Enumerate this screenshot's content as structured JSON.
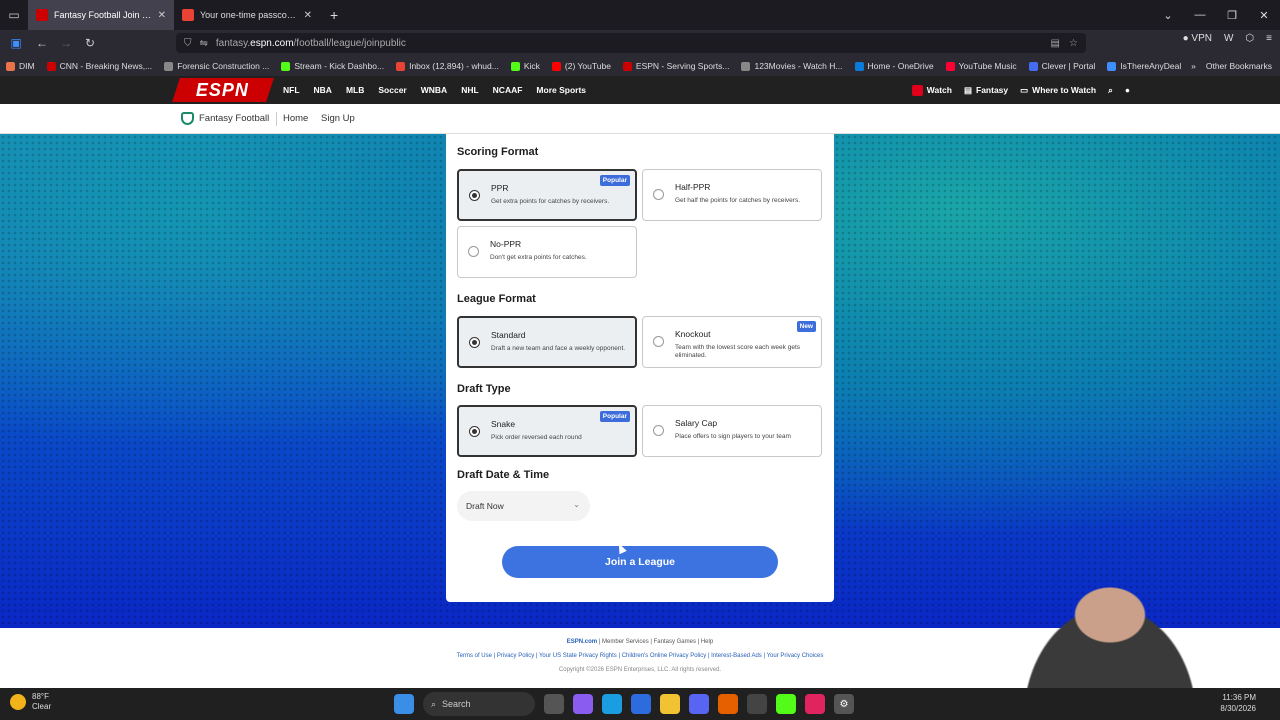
{
  "browser": {
    "tabs": [
      {
        "label": "Fantasy Football Join a Public L",
        "active": true
      },
      {
        "label": "Your one-time passcode for ESP",
        "active": false
      }
    ],
    "url_prefix": "fantasy.",
    "url_host": "espn.com",
    "url_path": "/football/league/joinpublic",
    "vpn_label": "VPN",
    "bookmarks": [
      {
        "label": "DIM",
        "color": "#e8734a"
      },
      {
        "label": "CNN - Breaking News,...",
        "color": "#cc0000"
      },
      {
        "label": "Forensic Construction ...",
        "color": "#888888"
      },
      {
        "label": "Stream - Kick Dashbo...",
        "color": "#53fc18"
      },
      {
        "label": "Inbox (12,894) - whud...",
        "color": "#ea4335"
      },
      {
        "label": "Kick",
        "color": "#53fc18"
      },
      {
        "label": "(2) YouTube",
        "color": "#ff0000"
      },
      {
        "label": "ESPN - Serving Sports...",
        "color": "#cc0000"
      },
      {
        "label": "123Movies - Watch H...",
        "color": "#888888"
      },
      {
        "label": "Home - OneDrive",
        "color": "#0a7bd8"
      },
      {
        "label": "YouTube Music",
        "color": "#ff0033"
      },
      {
        "label": "Clever | Portal",
        "color": "#436cf2"
      },
      {
        "label": "IsThereAnyDeal",
        "color": "#3d8eff"
      }
    ],
    "other_bookmarks": "Other Bookmarks"
  },
  "espn": {
    "logo": "ESPN",
    "links": [
      "NFL",
      "NBA",
      "MLB",
      "Soccer",
      "WNBA",
      "NHL",
      "NCAAF",
      "More Sports"
    ],
    "watch": "Watch",
    "fantasy": "Fantasy",
    "where_to_watch": "Where to Watch"
  },
  "subnav": {
    "title": "Fantasy Football",
    "home": "Home",
    "signup": "Sign Up"
  },
  "form": {
    "scoring": {
      "heading": "Scoring Format",
      "options": [
        {
          "title": "PPR",
          "desc": "Get extra points for catches by receivers.",
          "badge": "Popular",
          "selected": true
        },
        {
          "title": "Half-PPR",
          "desc": "Get half the points for catches by receivers.",
          "badge": "",
          "selected": false
        },
        {
          "title": "No-PPR",
          "desc": "Don't get extra points for catches.",
          "badge": "",
          "selected": false
        }
      ]
    },
    "league": {
      "heading": "League Format",
      "options": [
        {
          "title": "Standard",
          "desc": "Draft a new team and face a weekly opponent.",
          "badge": "",
          "selected": true
        },
        {
          "title": "Knockout",
          "desc": "Team with the lowest score each week gets eliminated.",
          "badge": "New",
          "selected": false
        }
      ]
    },
    "draft": {
      "heading": "Draft Type",
      "options": [
        {
          "title": "Snake",
          "desc": "Pick order reversed each round",
          "badge": "Popular",
          "selected": true
        },
        {
          "title": "Salary Cap",
          "desc": "Place offers to sign players to your team",
          "badge": "",
          "selected": false
        }
      ]
    },
    "date": {
      "heading": "Draft Date & Time",
      "value": "Draft Now"
    },
    "submit": "Join a League"
  },
  "footer": {
    "line1_brand": "ESPN.com",
    "line1_rest": " | Member Services | Fantasy Games | Help",
    "line2": "Terms of Use | Privacy Policy | Your US State Privacy Rights | Children's Online Privacy Policy | Interest-Based Ads | Your Privacy Choices",
    "line3": "Copyright ©2026 ESPN Enterprises, LLC. All rights reserved."
  },
  "taskbar": {
    "temp": "88°F",
    "condition": "Clear",
    "search": "Search",
    "time": "11:36 PM",
    "date": "8/30/2026"
  }
}
